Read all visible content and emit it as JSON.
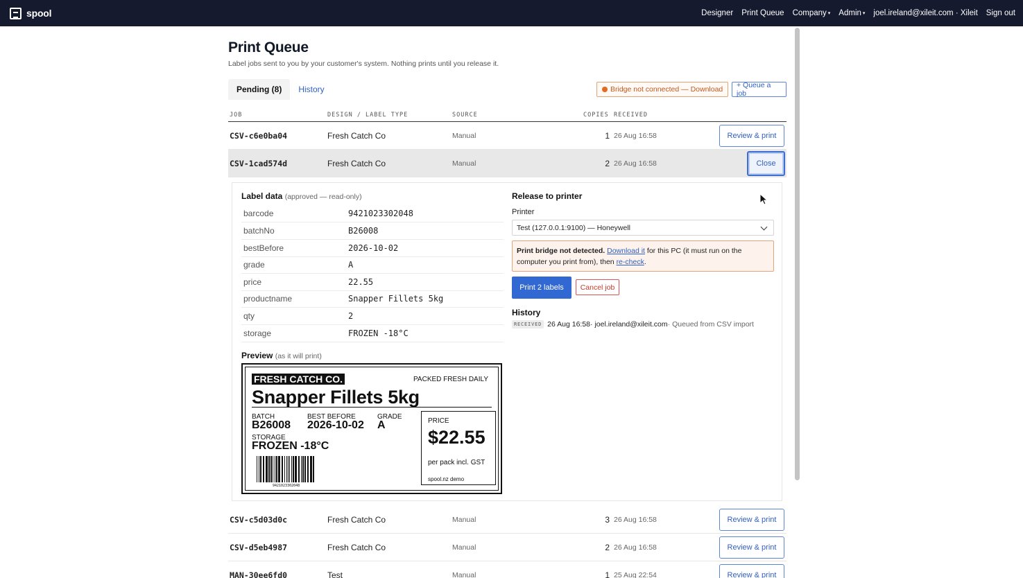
{
  "nav": {
    "brand": "spool",
    "links": [
      "Designer",
      "Print Queue",
      "Company",
      "Admin",
      "joel.ireland@xileit.com · Xileit",
      "Sign out"
    ],
    "caret": "▾"
  },
  "page": {
    "title": "Print Queue",
    "subtitle": "Label jobs sent to you by your customer's system. Nothing prints until you release it."
  },
  "tabs": {
    "pending": "Pending (8)",
    "history": "History"
  },
  "toolbar": {
    "bridge_label": "Bridge not connected — Download",
    "queue_label": "+ Queue a job",
    "bridge_color": "#e36a1e"
  },
  "table": {
    "headers": [
      "JOB",
      "DESIGN / LABEL TYPE",
      "SOURCE",
      "COPIES",
      "RECEIVED"
    ],
    "rows": [
      {
        "job": "CSV-c6e0ba04",
        "design": "Fresh Catch Co",
        "source": "Manual",
        "copies": "1",
        "received": "26 Aug 16:58",
        "action": "Review & print"
      },
      {
        "job": "CSV-1cad574d",
        "design": "Fresh Catch Co",
        "source": "Manual",
        "copies": "2",
        "received": "26 Aug 16:58",
        "action": "Close"
      },
      {
        "job": "CSV-c5d03d0c",
        "design": "Fresh Catch Co",
        "source": "Manual",
        "copies": "3",
        "received": "26 Aug 16:58",
        "action": "Review & print"
      },
      {
        "job": "CSV-d5eb4987",
        "design": "Fresh Catch Co",
        "source": "Manual",
        "copies": "2",
        "received": "26 Aug 16:58",
        "action": "Review & print"
      },
      {
        "job": "MAN-30ee6fd0",
        "design": "Test",
        "source": "Manual",
        "copies": "1",
        "received": "25 Aug 22:54",
        "action": "Review & print"
      }
    ]
  },
  "detail": {
    "label_data_title": "Label data",
    "label_data_note": "(approved — read-only)",
    "fields": [
      {
        "key": "barcode",
        "value": "9421023302048"
      },
      {
        "key": "batchNo",
        "value": "B26008"
      },
      {
        "key": "bestBefore",
        "value": "2026-10-02"
      },
      {
        "key": "grade",
        "value": "A"
      },
      {
        "key": "price",
        "value": "22.55"
      },
      {
        "key": "productname",
        "value": "Snapper Fillets 5kg"
      },
      {
        "key": "qty",
        "value": "2"
      },
      {
        "key": "storage",
        "value": "FROZEN -18°C"
      }
    ],
    "preview_title": "Preview",
    "preview_note": "(as it will print)",
    "label": {
      "brand": "FRESH CATCH CO.",
      "packed": "PACKED FRESH DAILY",
      "product": "Snapper Fillets 5kg",
      "batch_label": "BATCH",
      "batch": "B26008",
      "best_before_label": "BEST BEFORE",
      "best_before": "2026-10-02",
      "grade_label": "GRADE",
      "grade": "A",
      "storage_label": "STORAGE",
      "storage": "FROZEN -18°C",
      "barcode_number": "9421023302048",
      "price_label": "PRICE",
      "price": "$22.55",
      "price_note": "per pack incl. GST",
      "footer": "spool.nz demo"
    },
    "release_title": "Release to printer",
    "printer_label": "Printer",
    "printer_value": "Test (127.0.0.1:9100) — Honeywell",
    "warning": {
      "bold": "Print bridge not detected.",
      "link1": "Download it",
      "mid": " for this PC (it must run on the computer you print from), then ",
      "link2": "re-check",
      "end": "."
    },
    "print_button": "Print 2 labels",
    "cancel_button": "Cancel job",
    "history_title": "History",
    "history": {
      "badge": "RECEIVED",
      "time": "26 Aug 16:58",
      "user": "· joel.ireland@xileit.com",
      "note": "· Queued from CSV import"
    }
  }
}
